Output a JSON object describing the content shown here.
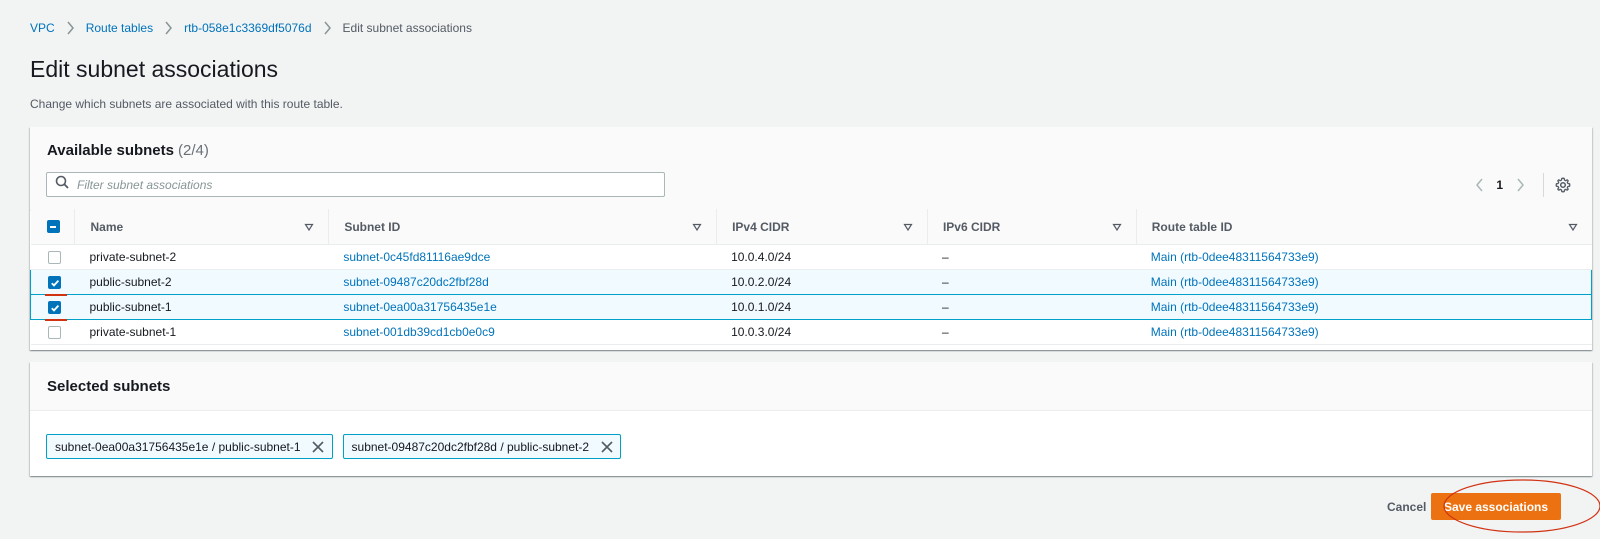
{
  "breadcrumb": {
    "items": [
      "VPC",
      "Route tables",
      "rtb-058e1c3369df5076d"
    ],
    "current": "Edit subnet associations"
  },
  "page": {
    "title": "Edit subnet associations",
    "description": "Change which subnets are associated with this route table."
  },
  "available": {
    "title": "Available subnets",
    "count": "(2/4)",
    "search_placeholder": "Filter subnet associations",
    "page_number": "1",
    "columns": [
      "Name",
      "Subnet ID",
      "IPv4 CIDR",
      "IPv6 CIDR",
      "Route table ID"
    ],
    "rows": [
      {
        "name": "private-subnet-2",
        "subnet_id": "subnet-0c45fd81116ae9dce",
        "ipv4": "10.0.4.0/24",
        "ipv6": "–",
        "route_table": "Main (rtb-0dee48311564733e9)",
        "checked": false
      },
      {
        "name": "public-subnet-2",
        "subnet_id": "subnet-09487c20dc2fbf28d",
        "ipv4": "10.0.2.0/24",
        "ipv6": "–",
        "route_table": "Main (rtb-0dee48311564733e9)",
        "checked": true
      },
      {
        "name": "public-subnet-1",
        "subnet_id": "subnet-0ea00a31756435e1e",
        "ipv4": "10.0.1.0/24",
        "ipv6": "–",
        "route_table": "Main (rtb-0dee48311564733e9)",
        "checked": true
      },
      {
        "name": "private-subnet-1",
        "subnet_id": "subnet-001db39cd1cb0e0c9",
        "ipv4": "10.0.3.0/24",
        "ipv6": "–",
        "route_table": "Main (rtb-0dee48311564733e9)",
        "checked": false
      }
    ]
  },
  "selected": {
    "title": "Selected subnets",
    "tokens": [
      "subnet-0ea00a31756435e1e / public-subnet-1",
      "subnet-09487c20dc2fbf28d / public-subnet-2"
    ]
  },
  "footer": {
    "cancel_label": "Cancel",
    "save_label": "Save associations"
  },
  "colors": {
    "link": "#0073bb",
    "primary_button": "#ec7211",
    "selected_row_bg": "#f1faff",
    "selected_border": "#00a1c9",
    "annotation_red": "#d13212"
  },
  "icons": [
    "chevron-right-icon",
    "search-icon",
    "chevron-left-icon",
    "gear-icon",
    "sort-down-icon",
    "check-icon",
    "minus-icon",
    "close-icon"
  ]
}
